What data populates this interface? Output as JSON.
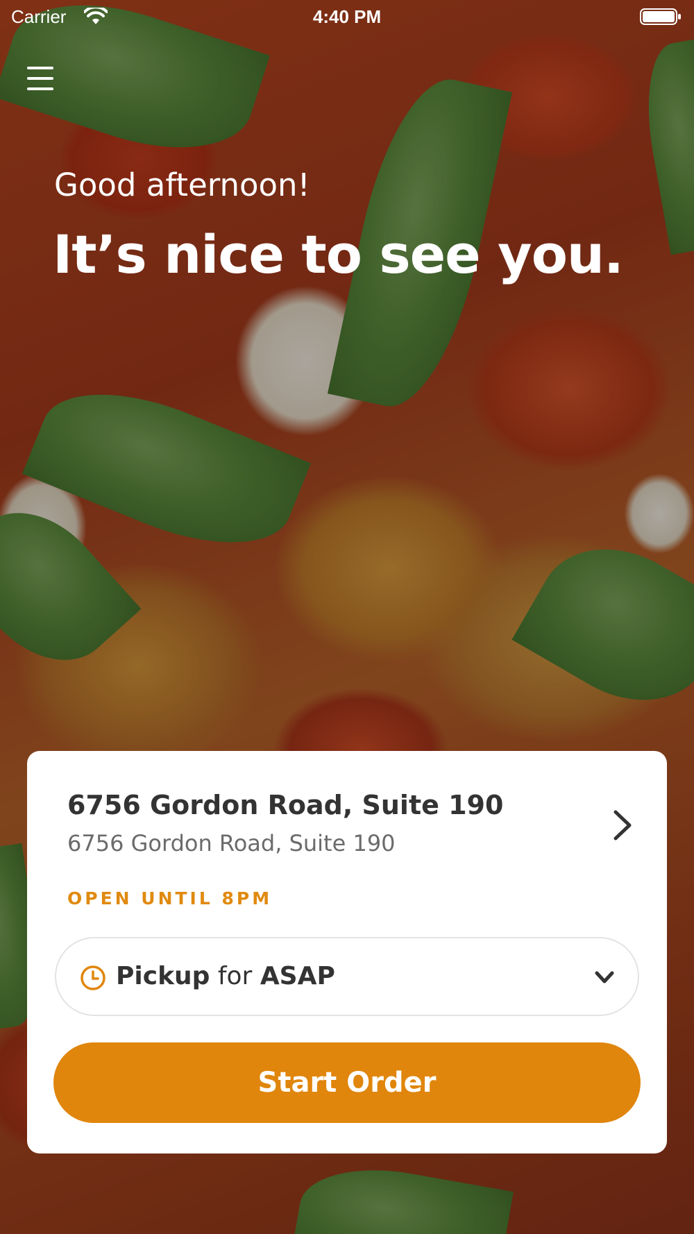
{
  "status_bar": {
    "carrier": "Carrier",
    "time": "4:40 PM"
  },
  "hero": {
    "greeting": "Good afternoon!",
    "headline": "It’s nice to see you."
  },
  "location_card": {
    "store_name": "6756 Gordon Road, Suite 190",
    "store_address": "6756 Gordon Road, Suite 190",
    "hours_status": "OPEN UNTIL 8PM",
    "order_mode": {
      "method": "Pickup",
      "connector": "for",
      "time": "ASAP"
    },
    "start_order_label": "Start Order"
  },
  "colors": {
    "accent": "#e0860c",
    "card_background": "#ffffff",
    "text_primary": "#333333",
    "text_secondary": "#6b6b6b"
  },
  "icons": {
    "menu": "hamburger-menu-icon",
    "wifi": "wifi-icon",
    "battery": "battery-icon",
    "chevron_right": "chevron-right-icon",
    "clock": "clock-icon",
    "chevron_down": "chevron-down-icon"
  }
}
